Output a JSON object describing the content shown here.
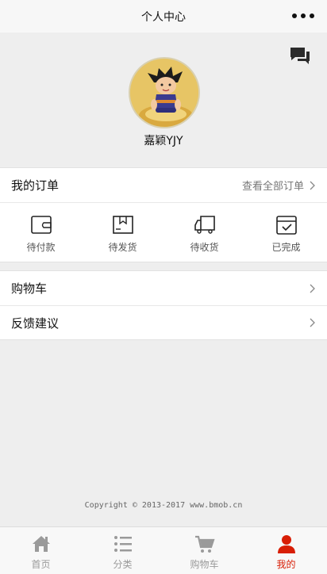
{
  "navbar": {
    "title": "个人中心"
  },
  "profile": {
    "username": "嘉颖YJY"
  },
  "orders": {
    "title": "我的订单",
    "view_all": "查看全部订单",
    "items": [
      {
        "label": "待付款",
        "icon": "wallet-icon"
      },
      {
        "label": "待发货",
        "icon": "box-icon"
      },
      {
        "label": "待收货",
        "icon": "truck-icon"
      },
      {
        "label": "已完成",
        "icon": "done-icon"
      }
    ]
  },
  "menu": {
    "cart": "购物车",
    "feedback": "反馈建议"
  },
  "footer": {
    "copyright": "Copyright © 2013-2017 www.bmob.cn"
  },
  "tabbar": {
    "items": [
      {
        "label": "首页",
        "icon": "home-icon"
      },
      {
        "label": "分类",
        "icon": "list-icon"
      },
      {
        "label": "购物车",
        "icon": "cart-icon"
      },
      {
        "label": "我的",
        "icon": "user-icon"
      }
    ],
    "active": "我的"
  },
  "colors": {
    "accent": "#d81e06",
    "inactive": "#9a9a9a",
    "background": "#eeeeee"
  }
}
